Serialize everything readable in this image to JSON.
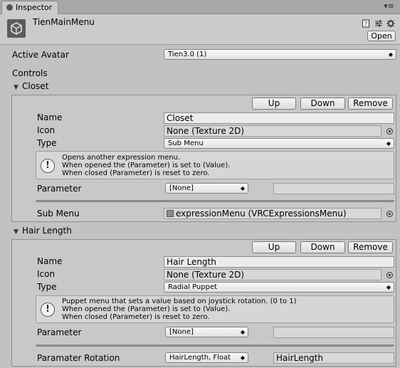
{
  "window": {
    "tab_label": "Inspector",
    "asset_title": "TienMainMenu",
    "open_button": "Open",
    "menu_glyph": "▾≡"
  },
  "avatar": {
    "label": "Active Avatar",
    "value": "Tien3.0 (1)"
  },
  "controls_label": "Controls",
  "controls": [
    {
      "foldout_label": "Closet",
      "buttons": {
        "up": "Up",
        "down": "Down",
        "remove": "Remove"
      },
      "name_label": "Name",
      "name_value": "Closet",
      "icon_label": "Icon",
      "icon_value": "None (Texture 2D)",
      "type_label": "Type",
      "type_value": "Sub Menu",
      "help_lines": [
        "Opens another expression menu.",
        "When opened the (Parameter) is set to (Value).",
        "When closed (Parameter) is reset to zero."
      ],
      "parameter_label": "Parameter",
      "parameter_value": "[None]",
      "submenu_label": "Sub Menu",
      "submenu_value": "expressionMenu (VRCExpressionsMenu)"
    },
    {
      "foldout_label": "Hair Length",
      "buttons": {
        "up": "Up",
        "down": "Down",
        "remove": "Remove"
      },
      "name_label": "Name",
      "name_value": "Hair Length",
      "icon_label": "Icon",
      "icon_value": "None (Texture 2D)",
      "type_label": "Type",
      "type_value": "Radial Puppet",
      "help_lines": [
        "Puppet menu that sets a value based on joystick rotation. (0 to 1)",
        "When opened the (Parameter) is set to (Value).",
        "When closed (Parameter) is reset to zero."
      ],
      "parameter_label": "Parameter",
      "parameter_value": "[None]",
      "rotation_label": "Paramater Rotation",
      "rotation_value": "HairLength, Float",
      "rotation_text": "HairLength"
    }
  ],
  "icons": {
    "tab": "inspector-icon",
    "asset": "unity-logo-icon",
    "help": "info-icon",
    "settings": "gear-icon",
    "preset": "sliders-icon",
    "book": "help-book-icon"
  }
}
